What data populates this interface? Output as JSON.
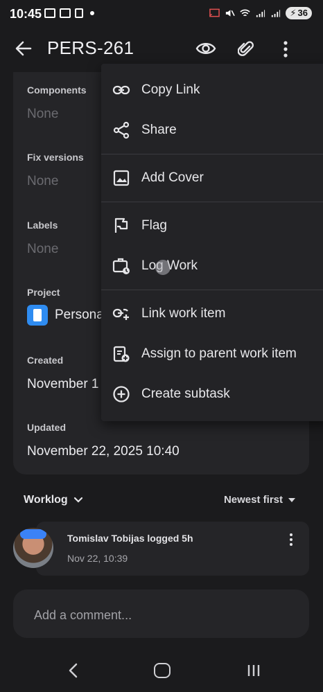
{
  "status_bar": {
    "time": "10:45",
    "battery": "36"
  },
  "app_bar": {
    "title": "PERS-261"
  },
  "details": {
    "components": {
      "label": "Components",
      "value": "None"
    },
    "fix_versions": {
      "label": "Fix versions",
      "value": "None"
    },
    "labels": {
      "label": "Labels",
      "value": "None"
    },
    "project": {
      "label": "Project",
      "value": "Persona"
    },
    "created": {
      "label": "Created",
      "value": "November 1"
    },
    "updated": {
      "label": "Updated",
      "value": "November 22, 2025 10:40"
    }
  },
  "worklog": {
    "title": "Worklog",
    "sort": "Newest first",
    "entries": [
      {
        "user_text": "Tomislav Tobijas logged 5h",
        "date": "Nov 22, 10:39"
      }
    ]
  },
  "comment": {
    "placeholder": "Add a comment..."
  },
  "menu": {
    "items": [
      {
        "label": "Copy Link",
        "icon": "link-icon"
      },
      {
        "label": "Share",
        "icon": "share-icon"
      },
      {
        "label": "Add Cover",
        "icon": "image-icon"
      },
      {
        "label": "Flag",
        "icon": "flag-icon"
      },
      {
        "label": "Log Work",
        "icon": "briefcase-clock-icon"
      },
      {
        "label": "Link work item",
        "icon": "link-add-icon"
      },
      {
        "label": "Assign to parent work item",
        "icon": "clipboard-add-icon"
      },
      {
        "label": "Create subtask",
        "icon": "plus-circle-icon"
      }
    ]
  },
  "colors": {
    "background": "#1b1b1d",
    "card": "#252528",
    "menu": "#232326",
    "project_icon": "#2f8cf1"
  }
}
